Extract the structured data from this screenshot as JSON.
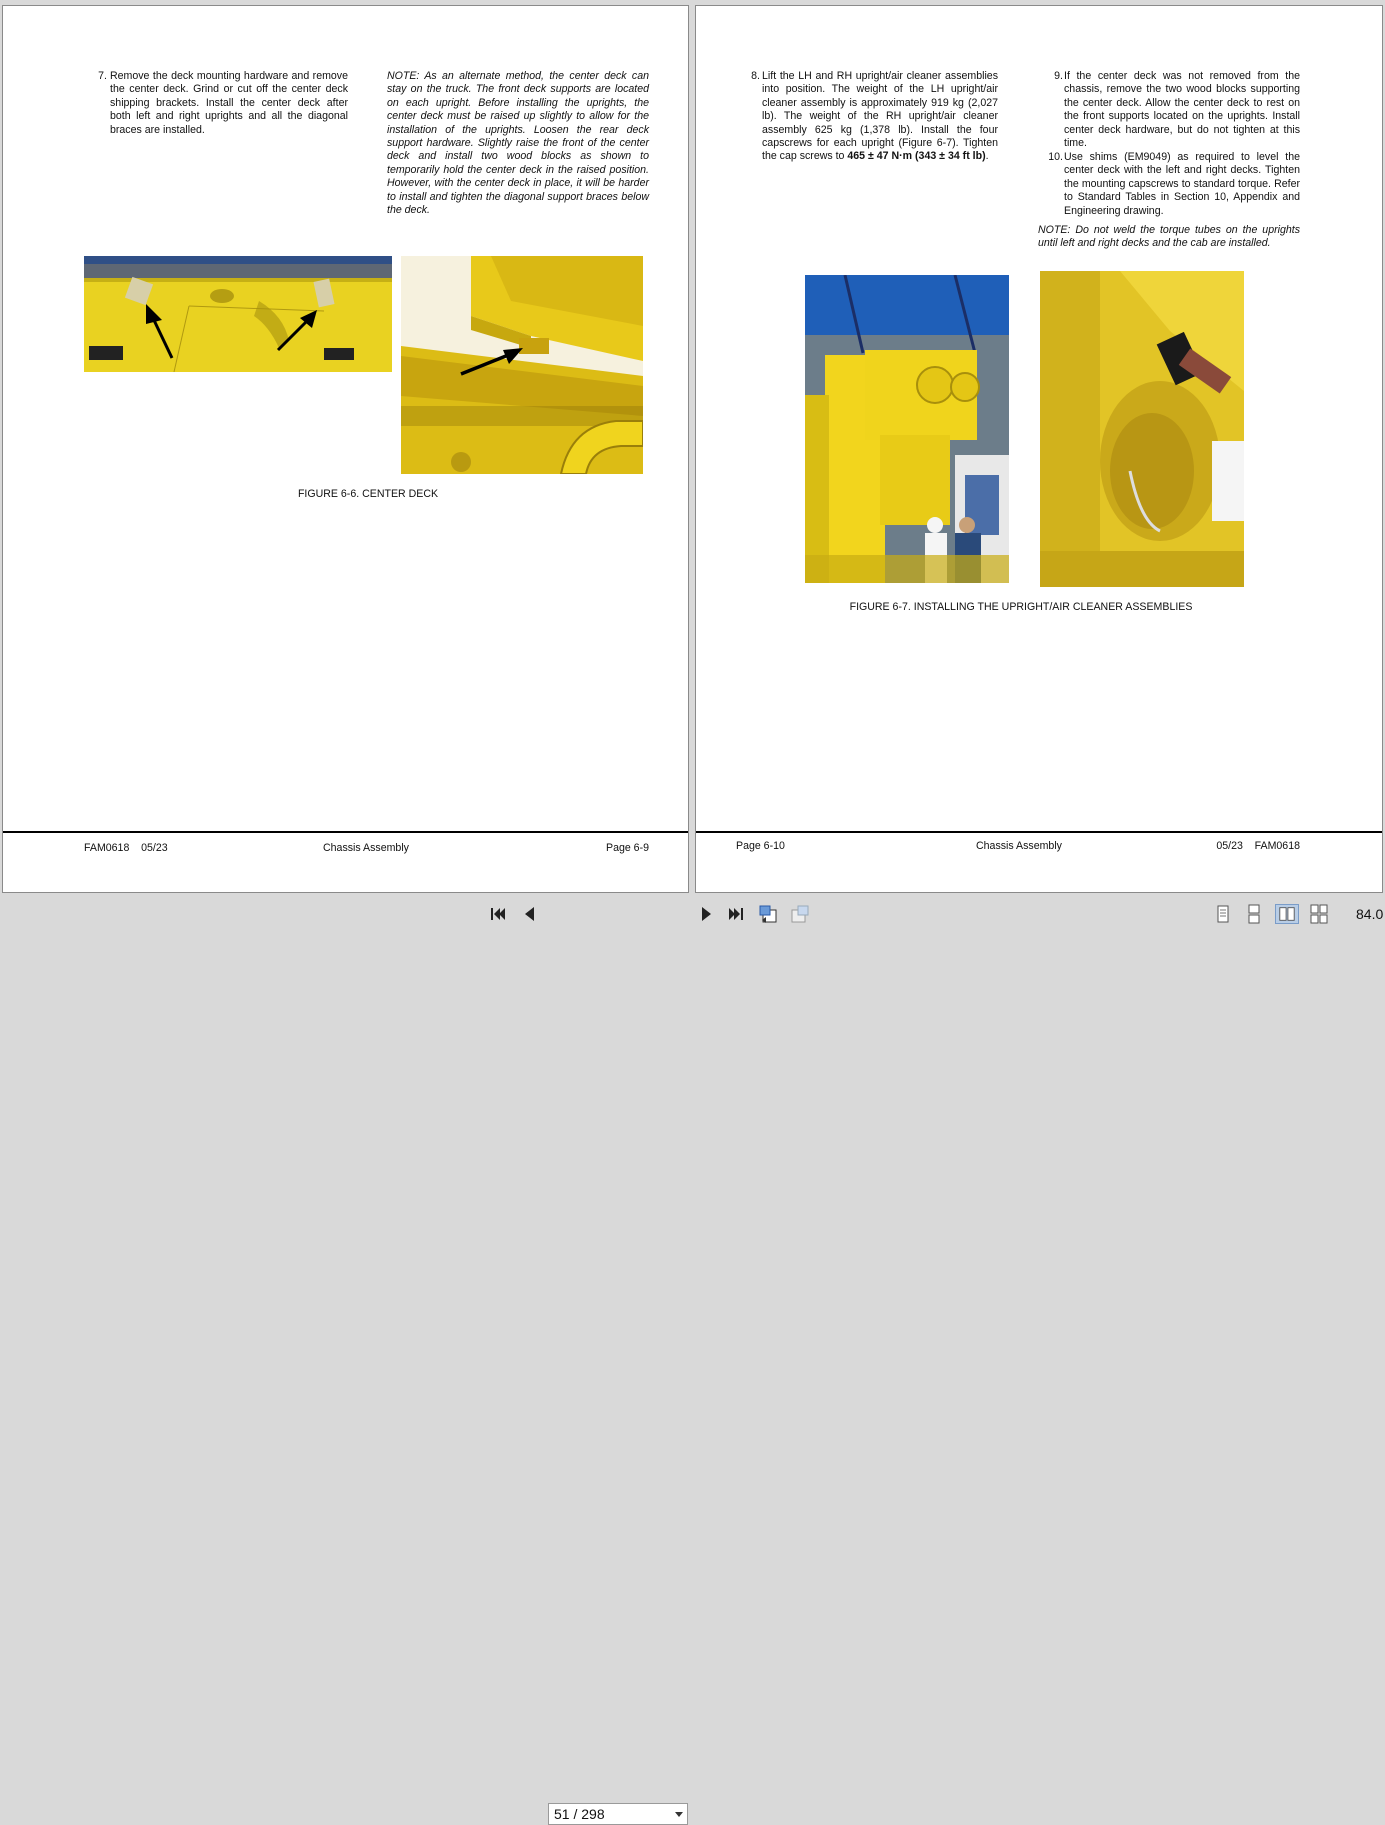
{
  "left_page": {
    "step7_num": "7.",
    "step7_text": "Remove the deck mounting hardware and remove the center deck. Grind or cut off the center deck shipping brackets. Install the center deck after both left and right uprights and all the diagonal braces are installed.",
    "note": "NOTE: As an alternate method, the center deck can stay on the truck. The front deck supports are located on each upright. Before installing the uprights, the center deck must be raised up slightly to allow for the installation of the uprights. Loosen the rear deck support hardware. Slightly raise the front of the center deck and install two wood blocks as shown to temporarily hold the center deck in the raised position. However, with the center deck in place, it will be harder to install and tighten the diagonal support braces below the deck.",
    "figure_caption": "FIGURE 6-6. CENTER DECK",
    "footer_left": "FAM0618    05/23",
    "footer_center": "Chassis Assembly",
    "footer_right": "Page 6-9"
  },
  "right_page": {
    "step8_num": "8.",
    "step8_text": "Lift the LH and RH upright/air cleaner assemblies into position. The weight of the LH upright/air cleaner assembly is approximately 919 kg (2,027 lb). The weight of the RH upright/air cleaner assembly 625 kg (1,378 lb). Install the four capscrews for each upright (Figure 6-7). Tighten the cap screws to ",
    "step8_bold": "465 ± 47 N·m (343 ± 34 ft lb)",
    "step8_end": ".",
    "step9_num": "9.",
    "step9_text": "If the center deck was not removed from the chassis, remove the two wood blocks supporting the center deck. Allow the center deck to rest on the front supports located on the uprights. Install center deck hardware, but do not tighten at this time.",
    "step10_num": "10.",
    "step10_text": "Use shims (EM9049) as required to level the center deck with the left and right decks. Tighten the mounting capscrews to standard torque. Refer to Standard Tables in Section 10, Appendix and Engineering drawing.",
    "note": "NOTE: Do not weld the torque tubes on the uprights until left and right decks and the cab are installed.",
    "figure_caption": "FIGURE 6-7. INSTALLING THE UPRIGHT/AIR CLEANER ASSEMBLIES",
    "footer_left": "Page 6-10",
    "footer_center": "Chassis Assembly",
    "footer_right": "05/23    FAM0618"
  },
  "toolbar": {
    "page_value": "51 / 298",
    "zoom": "84.0",
    "icons": [
      "first-page-icon",
      "previous-page-icon",
      "next-page-icon",
      "last-page-icon",
      "previous-view-icon",
      "next-view-icon",
      "single-page-icon",
      "continuous-icon",
      "facing-pages-icon",
      "continuous-facing-icon"
    ]
  },
  "colors": {
    "background": "#d9d9d9",
    "page": "#ffffff",
    "machine_yellow": "#f0d21c",
    "sky": "#1f5fb8"
  }
}
